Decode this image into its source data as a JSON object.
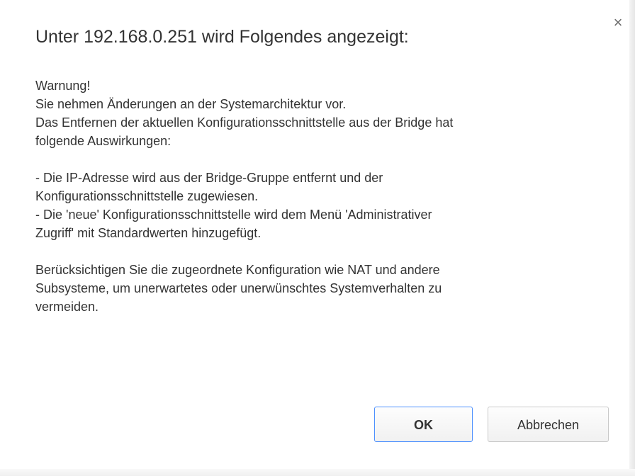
{
  "dialog": {
    "title": "Unter 192.168.0.251 wird Folgendes angezeigt:",
    "close_symbol": "×",
    "message_lines": [
      "Warnung!",
      "Sie nehmen Änderungen an der Systemarchitektur vor.",
      "Das Entfernen der aktuellen Konfigurationsschnittstelle aus der Bridge hat",
      "folgende Auswirkungen:",
      "",
      "- Die IP-Adresse wird aus der Bridge-Gruppe entfernt und der",
      "Konfigurationsschnittstelle zugewiesen.",
      "- Die 'neue' Konfigurationsschnittstelle wird dem Menü 'Administrativer",
      "Zugriff' mit Standardwerten hinzugefügt.",
      "",
      "Berücksichtigen Sie die zugeordnete Konfiguration wie NAT und andere",
      "Subsysteme, um unerwartetes oder unerwünschtes Systemverhalten zu",
      "vermeiden."
    ],
    "ok_label": "OK",
    "cancel_label": "Abbrechen"
  },
  "colors": {
    "text": "#333333",
    "focus_border": "#4d90fe",
    "button_border": "#c9c9c9",
    "close_icon": "#6b6b6b"
  },
  "icons": {
    "close": "close-icon"
  }
}
